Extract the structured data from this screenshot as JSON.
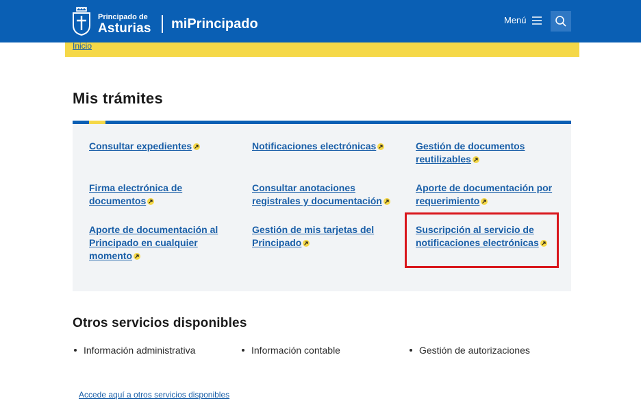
{
  "header": {
    "brand_line1": "Principado de",
    "brand_line2": "Asturias",
    "app_name": "miPrincipado",
    "menu_label": "Menú"
  },
  "breadcrumb": {
    "home": "Inicio"
  },
  "main": {
    "title": "Mis trámites",
    "tiles": [
      {
        "label": "Consultar expedientes"
      },
      {
        "label": "Notificaciones electrónicas"
      },
      {
        "label": "Gestión de documentos reutilizables"
      },
      {
        "label": "Firma electrónica de documentos"
      },
      {
        "label": "Consultar anotaciones registrales y documentación"
      },
      {
        "label": "Aporte de documentación por requerimiento"
      },
      {
        "label": "Aporte de documentación al Principado en cualquier momento"
      },
      {
        "label": "Gestión de mis tarjetas del Principado"
      },
      {
        "label": "Suscripción al servicio de notificaciones electrónicas"
      }
    ]
  },
  "other": {
    "title": "Otros servicios disponibles",
    "items": [
      {
        "label": "Información administrativa"
      },
      {
        "label": "Información contable"
      },
      {
        "label": "Gestión de autorizaciones"
      }
    ],
    "more_link": "Accede aquí a otros servicios disponibles"
  },
  "colors": {
    "brand_blue": "#0a5fb4",
    "accent_yellow": "#f5d848",
    "link_blue": "#1a5fa8",
    "highlight_red": "#d9161c"
  }
}
